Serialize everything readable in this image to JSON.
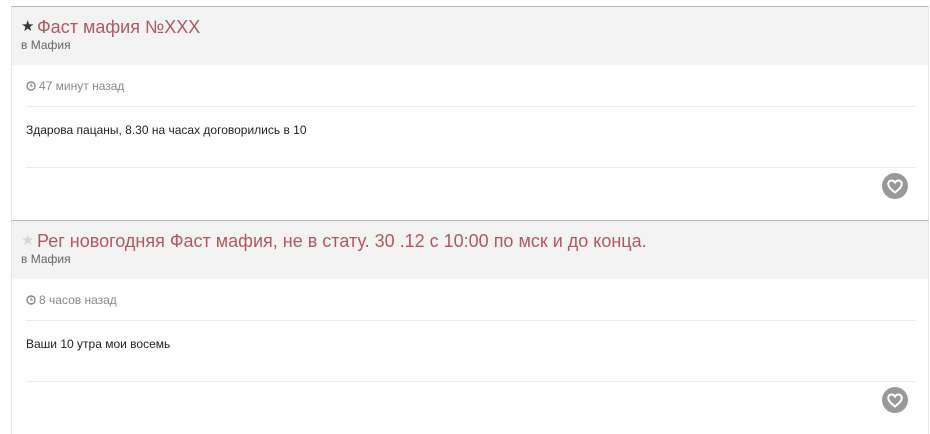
{
  "posts": [
    {
      "starred": true,
      "title": "Фаст мафия №XXX",
      "category": "в Мафия",
      "time": "47 минут назад",
      "text": "Здарова пацаны, 8.30 на часах договорились в 10",
      "star_icon": "star-filled-icon",
      "like_icon": "heart-icon"
    },
    {
      "starred": false,
      "title": "Рег новогодняя Фаст мафия, не в стату. 30 .12 с 10:00 по мск и до конца.",
      "category": "в Мафия",
      "time": "8 часов назад",
      "text": "Ваши 10 утра мои восемь",
      "star_icon": "star-outline-icon",
      "like_icon": "heart-icon"
    }
  ],
  "colors": {
    "title": "#b2585f",
    "header_bg": "#f3f3f3",
    "like_button": "#999999"
  }
}
